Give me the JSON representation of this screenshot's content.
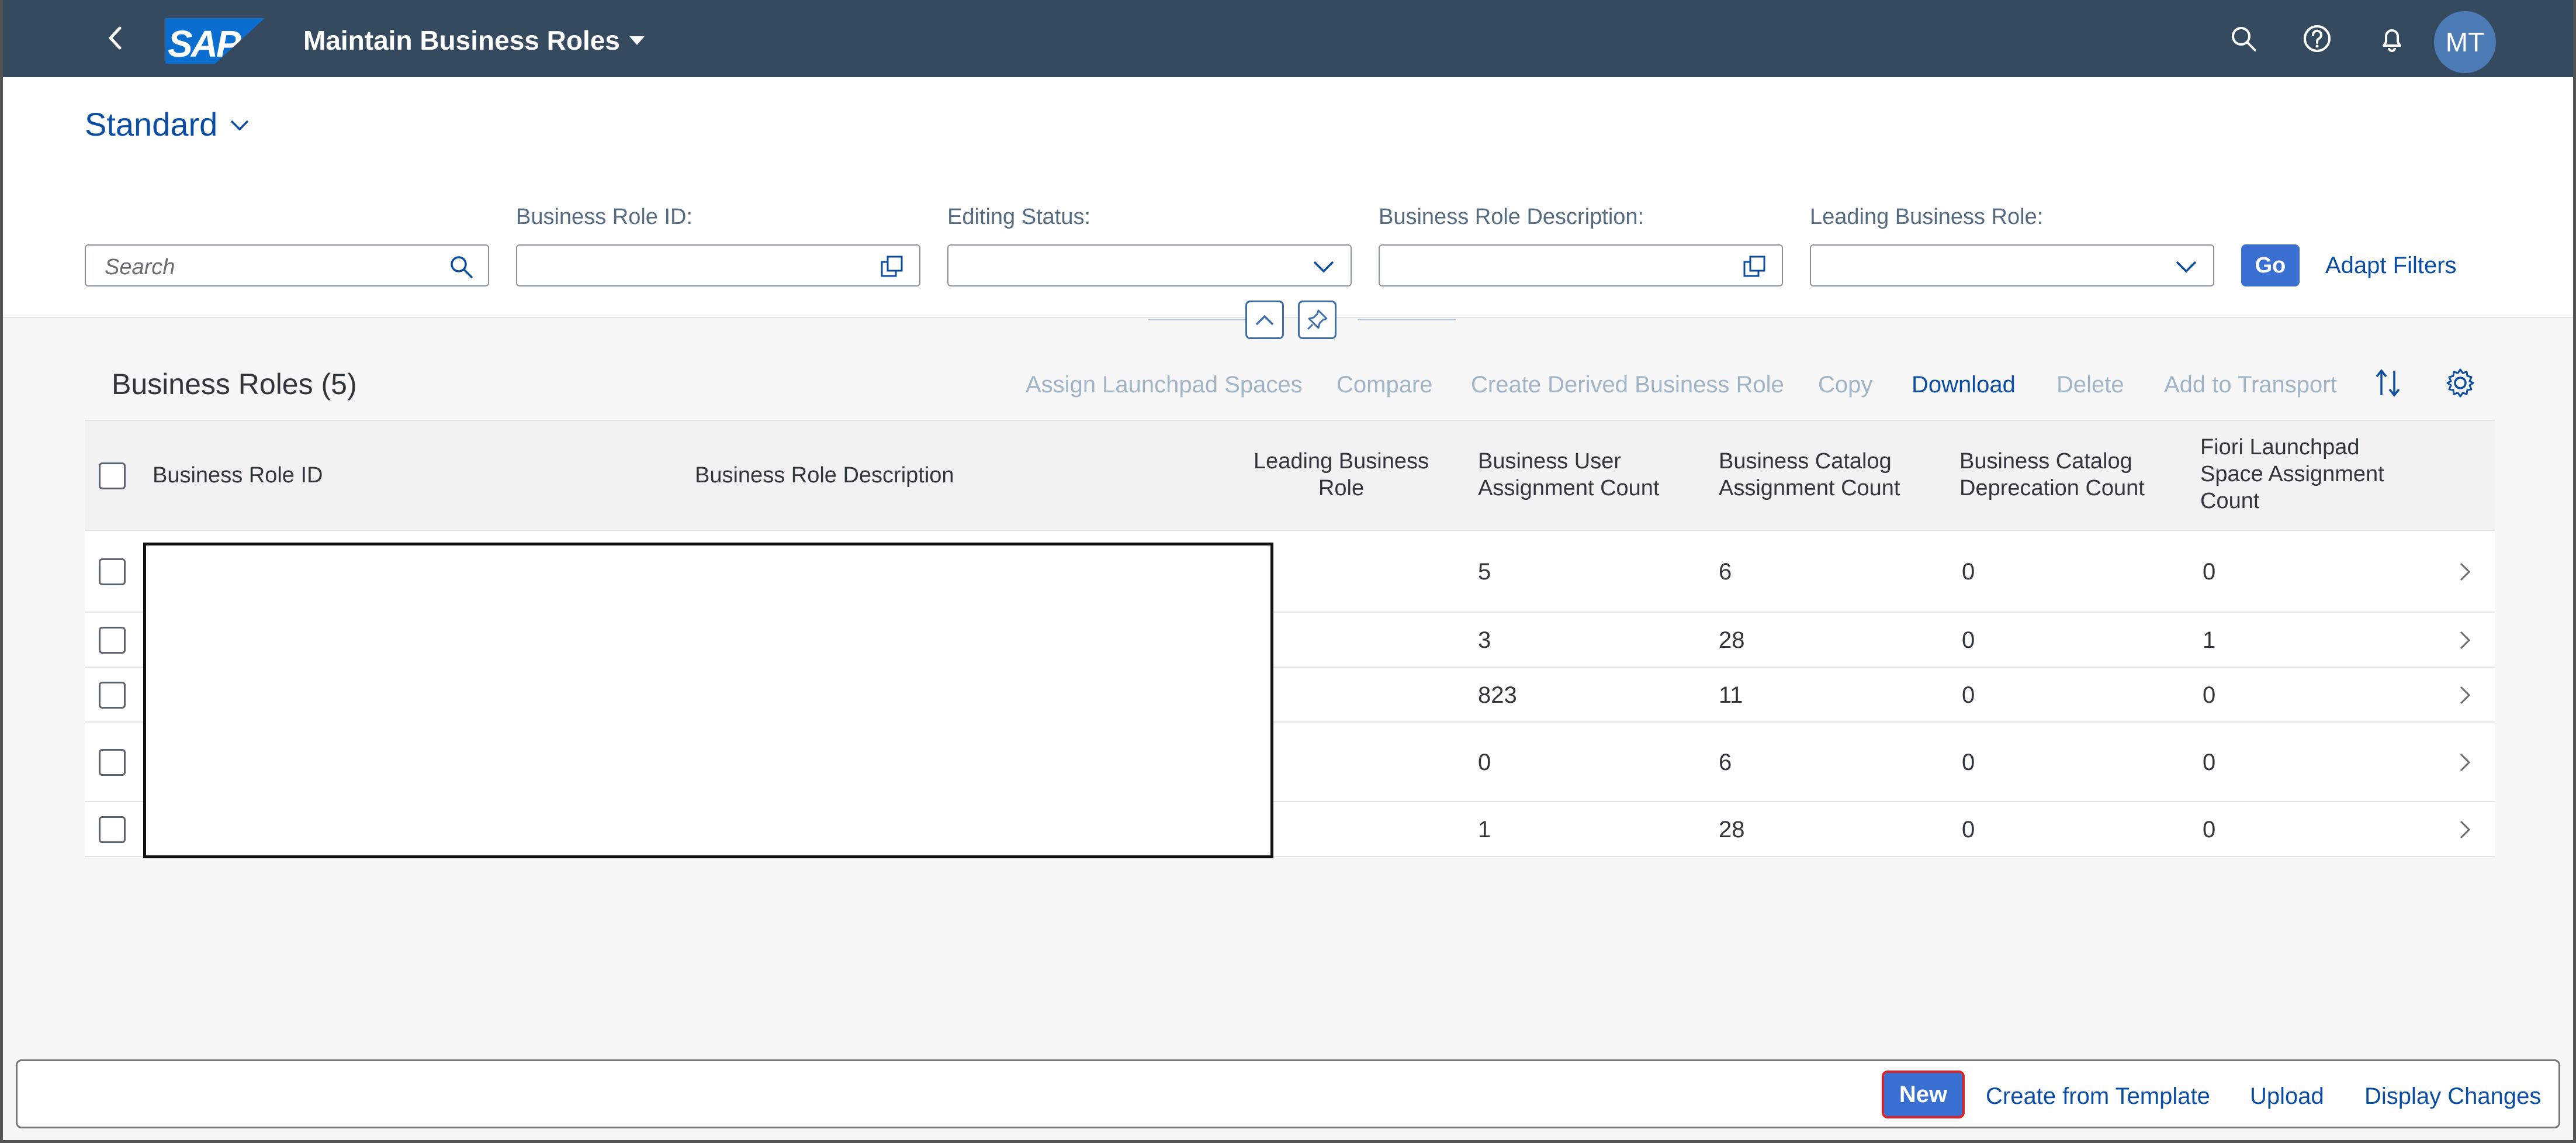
{
  "shell": {
    "logo_text": "SAP",
    "app_title": "Maintain Business Roles",
    "avatar_initials": "MT"
  },
  "variant": {
    "name": "Standard"
  },
  "filters": {
    "search_placeholder": "Search",
    "business_role_id_label": "Business Role ID:",
    "editing_status_label": "Editing Status:",
    "business_role_description_label": "Business Role Description:",
    "leading_business_role_label": "Leading Business Role:",
    "go_label": "Go",
    "adapt_filters_label": "Adapt Filters"
  },
  "table_toolbar": {
    "title": "Business Roles (5)",
    "actions": {
      "assign_spaces": "Assign Launchpad Spaces",
      "compare": "Compare",
      "create_derived": "Create Derived Business Role",
      "copy": "Copy",
      "download": "Download",
      "delete": "Delete",
      "add_to_transport": "Add to Transport"
    }
  },
  "table": {
    "columns": {
      "role_id": "Business Role ID",
      "role_description": "Business Role Description",
      "leading_role": "Leading Business Role",
      "user_count": "Business User Assignment Count",
      "catalog_count": "Business Catalog Assignment Count",
      "deprecation_count": "Business Catalog Deprecation Count",
      "space_count": "Fiori Launchpad Space Assignment Count"
    },
    "rows": [
      {
        "user_count": "5",
        "catalog_count": "6",
        "deprecation_count": "0",
        "space_count": "0"
      },
      {
        "user_count": "3",
        "catalog_count": "28",
        "deprecation_count": "0",
        "space_count": "1"
      },
      {
        "user_count": "823",
        "catalog_count": "11",
        "deprecation_count": "0",
        "space_count": "0"
      },
      {
        "user_count": "0",
        "catalog_count": "6",
        "deprecation_count": "0",
        "space_count": "0"
      },
      {
        "user_count": "1",
        "catalog_count": "28",
        "deprecation_count": "0",
        "space_count": "0"
      }
    ]
  },
  "footer": {
    "new_label": "New",
    "create_from_template_label": "Create from Template",
    "upload_label": "Upload",
    "display_changes_label": "Display Changes"
  },
  "colors": {
    "shell_bg": "#354a5f",
    "accent": "#3a6fd2",
    "link": "#0a4da2",
    "disabled_action": "#a0b4c8",
    "highlight_border": "#d8232a"
  }
}
